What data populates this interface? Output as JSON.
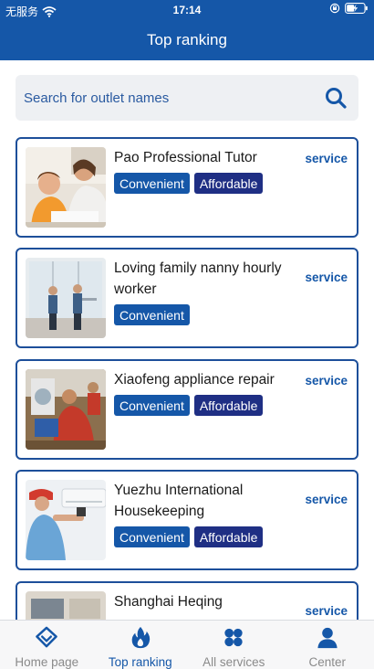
{
  "status": {
    "carrier": "无服务",
    "time": "17:14"
  },
  "header": {
    "title": "Top ranking"
  },
  "search": {
    "placeholder": "Search for outlet names"
  },
  "listings": [
    {
      "title": "Pao Professional Tutor",
      "action": "service",
      "tags": [
        "Convenient",
        "Affordable"
      ]
    },
    {
      "title": "Loving family nanny hourly worker",
      "action": "service",
      "tags": [
        "Convenient"
      ]
    },
    {
      "title": "Xiaofeng appliance repair",
      "action": "service",
      "tags": [
        "Convenient",
        "Affordable"
      ]
    },
    {
      "title": "Yuezhu International Housekeeping",
      "action": "service",
      "tags": [
        "Convenient",
        "Affordable"
      ]
    },
    {
      "title": "Shanghai Heqing",
      "action": "service",
      "tags": []
    }
  ],
  "tabbar": {
    "active": "Top ranking",
    "items": [
      {
        "label": "Home page",
        "icon": "diamond-icon"
      },
      {
        "label": "Top ranking",
        "icon": "flame-icon"
      },
      {
        "label": "All services",
        "icon": "grid-icon"
      },
      {
        "label": "Center",
        "icon": "person-icon"
      }
    ]
  },
  "colors": {
    "brand": "#1557a8",
    "tag_secondary": "#1f2f84",
    "inactive": "#8a8a8a"
  }
}
